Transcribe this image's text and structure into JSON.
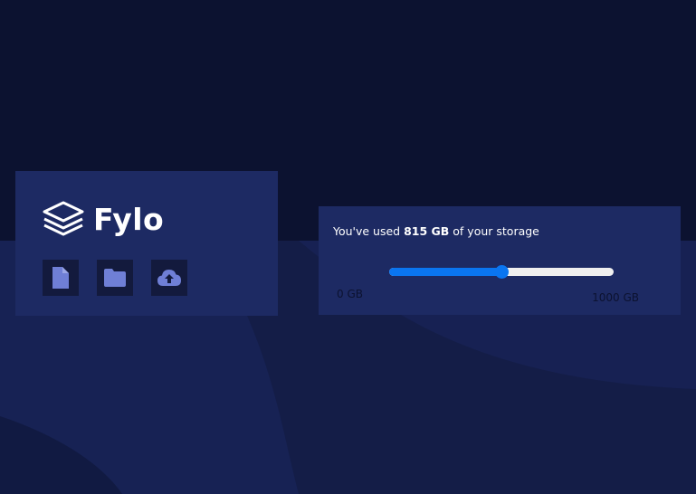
{
  "brand": {
    "name": "Fylo",
    "logo_icon": "layers-icon"
  },
  "toolbar": {
    "buttons": [
      {
        "icon": "document-icon"
      },
      {
        "icon": "folder-icon"
      },
      {
        "icon": "cloud-upload-icon"
      }
    ]
  },
  "storage": {
    "prefix": "You've used ",
    "used": "815 GB",
    "suffix": " of your storage",
    "min_label": "0 GB",
    "max_label": "1000 GB",
    "used_fraction": 0.5
  },
  "colors": {
    "background": "#0c1230",
    "card": "#1d2a63",
    "icon": "#6f7fd6",
    "accent": "#0a75f0"
  }
}
